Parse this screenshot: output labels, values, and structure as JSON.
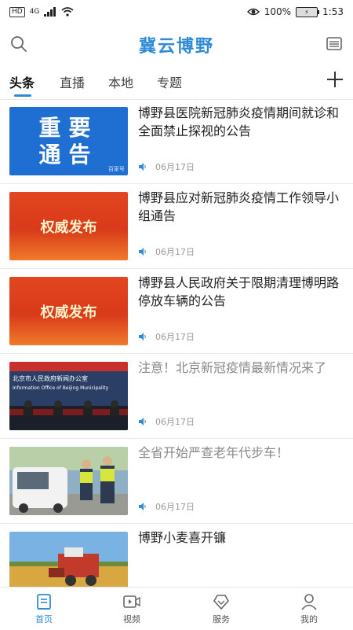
{
  "status_bar": {
    "hd": "HD",
    "signal": "4G",
    "battery_label": "100%",
    "battery_inner": "⚡",
    "time": "1:53"
  },
  "header": {
    "title": "冀云博野"
  },
  "tabs": [
    {
      "label": "头条"
    },
    {
      "label": "直播"
    },
    {
      "label": "本地"
    },
    {
      "label": "专题"
    }
  ],
  "feed": [
    {
      "title": "博野县医院新冠肺炎疫情期间就诊和全面禁止探视的公告",
      "date": "06月17日",
      "thumb": {
        "line1": "重要",
        "line2": "通告",
        "corner": "百家号"
      }
    },
    {
      "title": "博野县应对新冠肺炎疫情工作领导小组通告",
      "date": "06月17日",
      "thumb": {
        "text": "权威发布"
      }
    },
    {
      "title": "博野县人民政府关于限期清理博明路停放车辆的公告",
      "date": "06月17日",
      "thumb": {
        "text": "权威发布"
      }
    },
    {
      "title": "注意！北京新冠疫情最新情况来了",
      "date": "06月17日",
      "thumb": {
        "caption_cn": "北京市人民政府新闻办公室",
        "caption_en": "Information Office of Beijing Municipality"
      }
    },
    {
      "title": "全省开始严查老年代步车！",
      "date": "06月17日"
    },
    {
      "title": "博野小麦喜开镰"
    }
  ],
  "bottom_nav": [
    {
      "label": "首页"
    },
    {
      "label": "视频"
    },
    {
      "label": "服务"
    },
    {
      "label": "我的"
    }
  ],
  "colors": {
    "accent": "#2f8bd6",
    "notice_blue": "#1f6fd3",
    "authority_red": "#e2461f"
  }
}
